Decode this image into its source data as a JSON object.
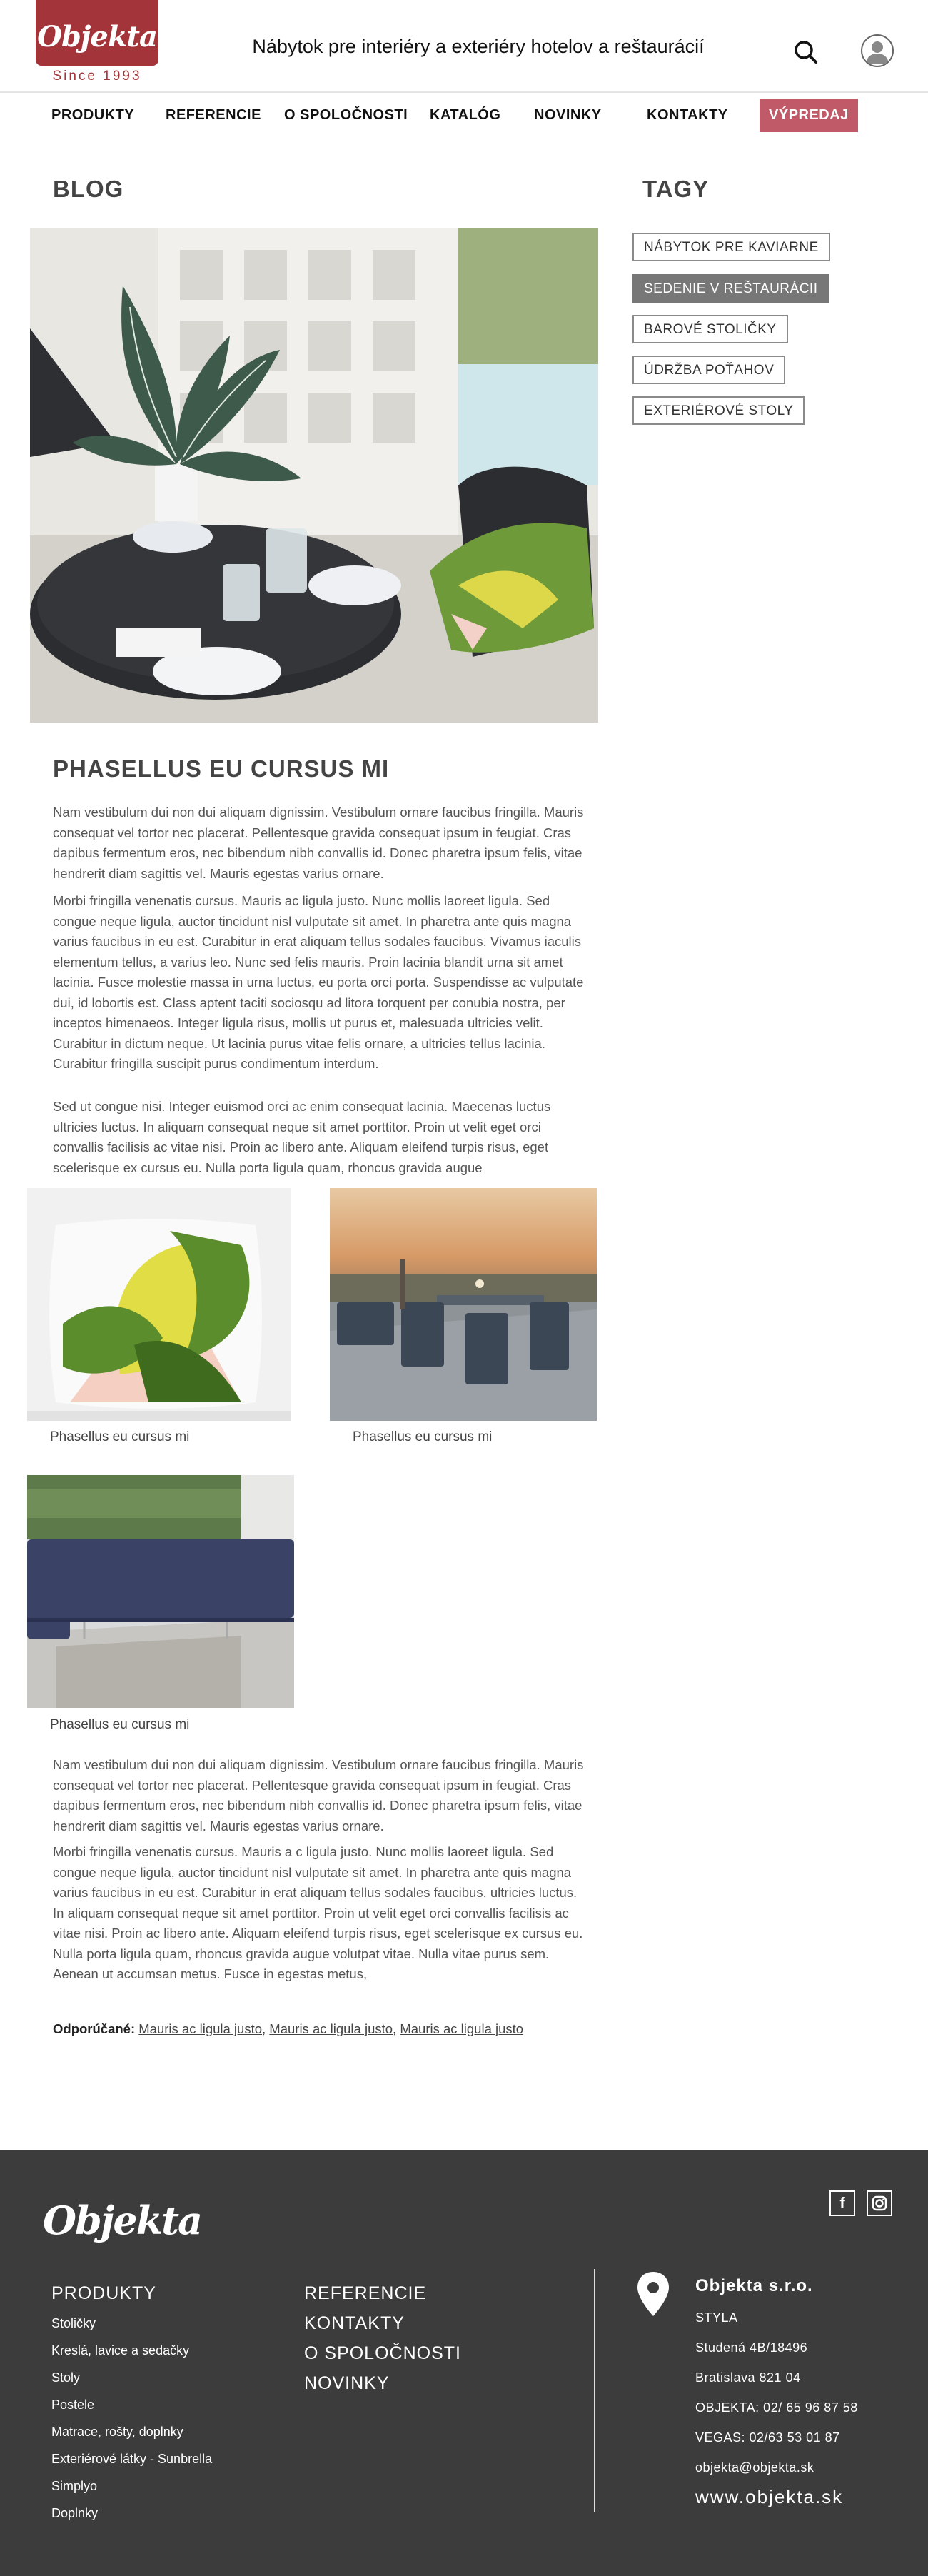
{
  "header": {
    "logo": "Objekta",
    "since": "Since 1993",
    "tagline": "Nábytok pre interiéry a exteriéry hotelov a reštaurácií"
  },
  "nav": {
    "items": [
      "PRODUKTY",
      "REFERENCIE",
      "O SPOLOČNOSTI",
      "KATALÓG",
      "NOVINKY",
      "KONTAKTY"
    ],
    "sale": "VÝPREDAJ"
  },
  "blog": {
    "heading": "BLOG",
    "post_title": "PHASELLUS EU CURSUS MI",
    "paragraphs": [
      "Nam vestibulum dui non dui aliquam dignissim. Vestibulum ornare faucibus fringilla. Mauris consequat vel tortor nec placerat. Pellentesque gravida consequat ipsum in feugiat. Cras dapibus fermentum eros, nec bibendum nibh convallis id. Donec pharetra ipsum felis, vitae hendrerit diam sagittis vel. Mauris egestas varius ornare.",
      "Morbi fringilla venenatis cursus. Mauris ac ligula justo. Nunc mollis laoreet ligula. Sed congue neque ligula, auctor tincidunt nisl vulputate sit amet. In pharetra ante quis magna varius faucibus in eu est. Curabitur in erat aliquam tellus sodales faucibus. Vivamus iaculis elementum tellus, a varius leo. Nunc sed felis mauris. Proin lacinia blandit urna sit amet lacinia. Fusce molestie massa in urna luctus, eu porta orci porta. Suspendisse ac vulputate dui, id lobortis est. Class aptent taciti sociosqu ad litora torquent per conubia nostra, per inceptos himenaeos. Integer ligula risus, mollis ut purus et, malesuada ultricies velit. Curabitur in dictum neque. Ut lacinia purus vitae felis ornare, a ultricies tellus lacinia. Curabitur fringilla suscipit purus condimentum interdum.",
      "Sed ut congue nisi. Integer euismod orci ac enim consequat lacinia. Maecenas luctus ultricies luctus. In aliquam consequat neque sit amet porttitor. Proin ut velit eget orci convallis facilisis ac vitae nisi. Proin ac libero ante. Aliquam eleifend turpis risus, eget scelerisque ex cursus eu. Nulla porta ligula quam, rhoncus gravida augue",
      "Nam vestibulum dui non dui aliquam dignissim. Vestibulum ornare faucibus fringilla. Mauris consequat vel tortor nec placerat. Pellentesque gravida consequat ipsum in feugiat. Cras dapibus fermentum eros, nec bibendum nibh convallis id. Donec pharetra ipsum felis, vitae hendrerit diam sagittis vel. Mauris egestas varius ornare.",
      "Morbi fringilla venenatis cursus. Mauris a c ligula justo. Nunc mollis laoreet ligula. Sed congue neque ligula, auctor tincidunt nisl vulputate sit amet. In pharetra ante quis magna varius faucibus in eu est. Curabitur in erat aliquam tellus sodales faucibus. ultricies luctus. In aliquam consequat neque sit amet porttitor. Proin ut velit eget orci convallis facilisis ac vitae nisi. Proin ac libero ante. Aliquam eleifend turpis risus, eget scelerisque ex cursus eu. Nulla porta ligula quam, rhoncus gravida augue volutpat vitae. Nulla vitae purus sem. Aenean ut accumsan metus. Fusce in egestas metus,"
    ],
    "captions": [
      "Phasellus eu cursus mi",
      "Phasellus eu cursus mi",
      "Phasellus eu cursus mi"
    ],
    "recommend_label": "Odporúčané:",
    "recommend_links": [
      "Mauris ac ligula justo",
      "Mauris ac ligula justo",
      "Mauris ac ligula justo"
    ]
  },
  "tags": {
    "heading": "TAGY",
    "items": [
      "NÁBYTOK PRE KAVIARNE",
      "SEDENIE V REŠTAURÁCII",
      "BAROVÉ STOLIČKY",
      "ÚDRŽBA POŤAHOV",
      "EXTERIÉROVÉ STOLY"
    ],
    "active_index": 1
  },
  "footer": {
    "logo": "Objekta",
    "social": [
      "f",
      "◎"
    ],
    "products_heading": "PRODUKTY",
    "products": [
      "Stoličky",
      "Kreslá, lavice a sedačky",
      "Stoly",
      "Postele",
      "Matrace, rošty, doplnky",
      "Exteriérové látky - Sunbrella",
      "Simplyo",
      "Doplnky"
    ],
    "links": [
      "REFERENCIE",
      "KONTAKTY",
      "O SPOLOČNOSTI",
      "NOVINKY"
    ],
    "company": "Objekta s.r.o.",
    "info": [
      "STYLA",
      "Studená 4B/18496",
      "Bratislava 821 04",
      "OBJEKTA: 02/ 65 96 87 58",
      "VEGAS: 02/63 53 01 87",
      "objekta@objekta.sk"
    ],
    "web": "www.objekta.sk"
  },
  "colors": {
    "brand": "#a3343a",
    "sale": "#c05a68",
    "footer_bg": "#3c3c3c",
    "tag_active": "#777777"
  }
}
